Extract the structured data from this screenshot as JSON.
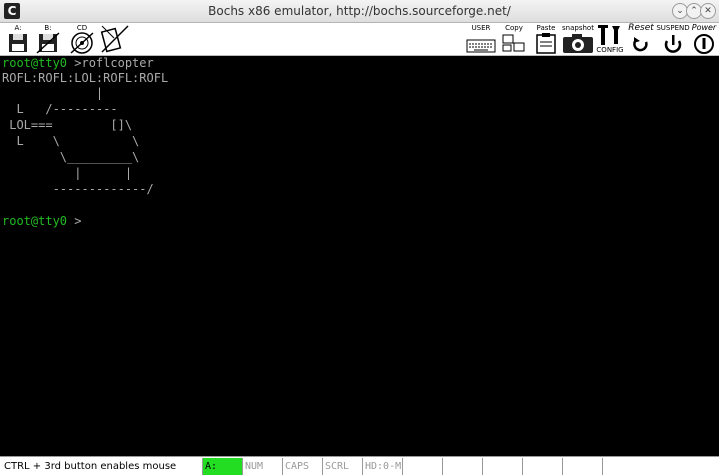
{
  "window": {
    "title": "Bochs x86 emulator, http://bochs.sourceforge.net/",
    "app_icon_glyph": "C"
  },
  "toolbar": {
    "left": [
      {
        "label": "A:",
        "icon": "floppy-a-icon"
      },
      {
        "label": "B:",
        "icon": "floppy-b-icon"
      },
      {
        "label": "CD",
        "icon": "cdrom-icon"
      },
      {
        "label": "",
        "icon": "network-disabled-icon"
      }
    ],
    "right": [
      {
        "label": "USER",
        "icon": "keyboard-icon"
      },
      {
        "label": "Copy",
        "icon": "copy-icon"
      },
      {
        "label": "Paste",
        "icon": "paste-icon"
      },
      {
        "label": "snapshot",
        "icon": "camera-icon"
      },
      {
        "label": "CONFIG",
        "icon": "config-icon"
      },
      {
        "label": "Reset",
        "icon": "reset-icon"
      },
      {
        "label": "SUSPEND",
        "icon": "suspend-icon"
      },
      {
        "label": "Power",
        "icon": "power-icon"
      }
    ]
  },
  "terminal": {
    "lines": [
      {
        "prompt": "root@tty0 ",
        "command": ">roflcopter"
      },
      {
        "text": "ROFL:ROFL:LOL:ROFL:ROFL"
      },
      {
        "text": "             |"
      },
      {
        "text": "  L   /---------"
      },
      {
        "text": " LOL===        []\\"
      },
      {
        "text": "  L    \\          \\"
      },
      {
        "text": "        \\_________\\"
      },
      {
        "text": "          |      |"
      },
      {
        "text": "       -------------/"
      },
      {
        "text": ""
      },
      {
        "prompt": "root@tty0 ",
        "command": ">"
      }
    ]
  },
  "status": {
    "message": "CTRL + 3rd button enables mouse",
    "indicators": [
      "A:",
      "NUM",
      "CAPS",
      "SCRL",
      "HD:0-M",
      "",
      "",
      "",
      "",
      ""
    ]
  },
  "colors": {
    "terminal_bg": "#000000",
    "terminal_text": "#aaaaaa",
    "prompt_green": "#22bb22",
    "led_active": "#22dd22"
  }
}
